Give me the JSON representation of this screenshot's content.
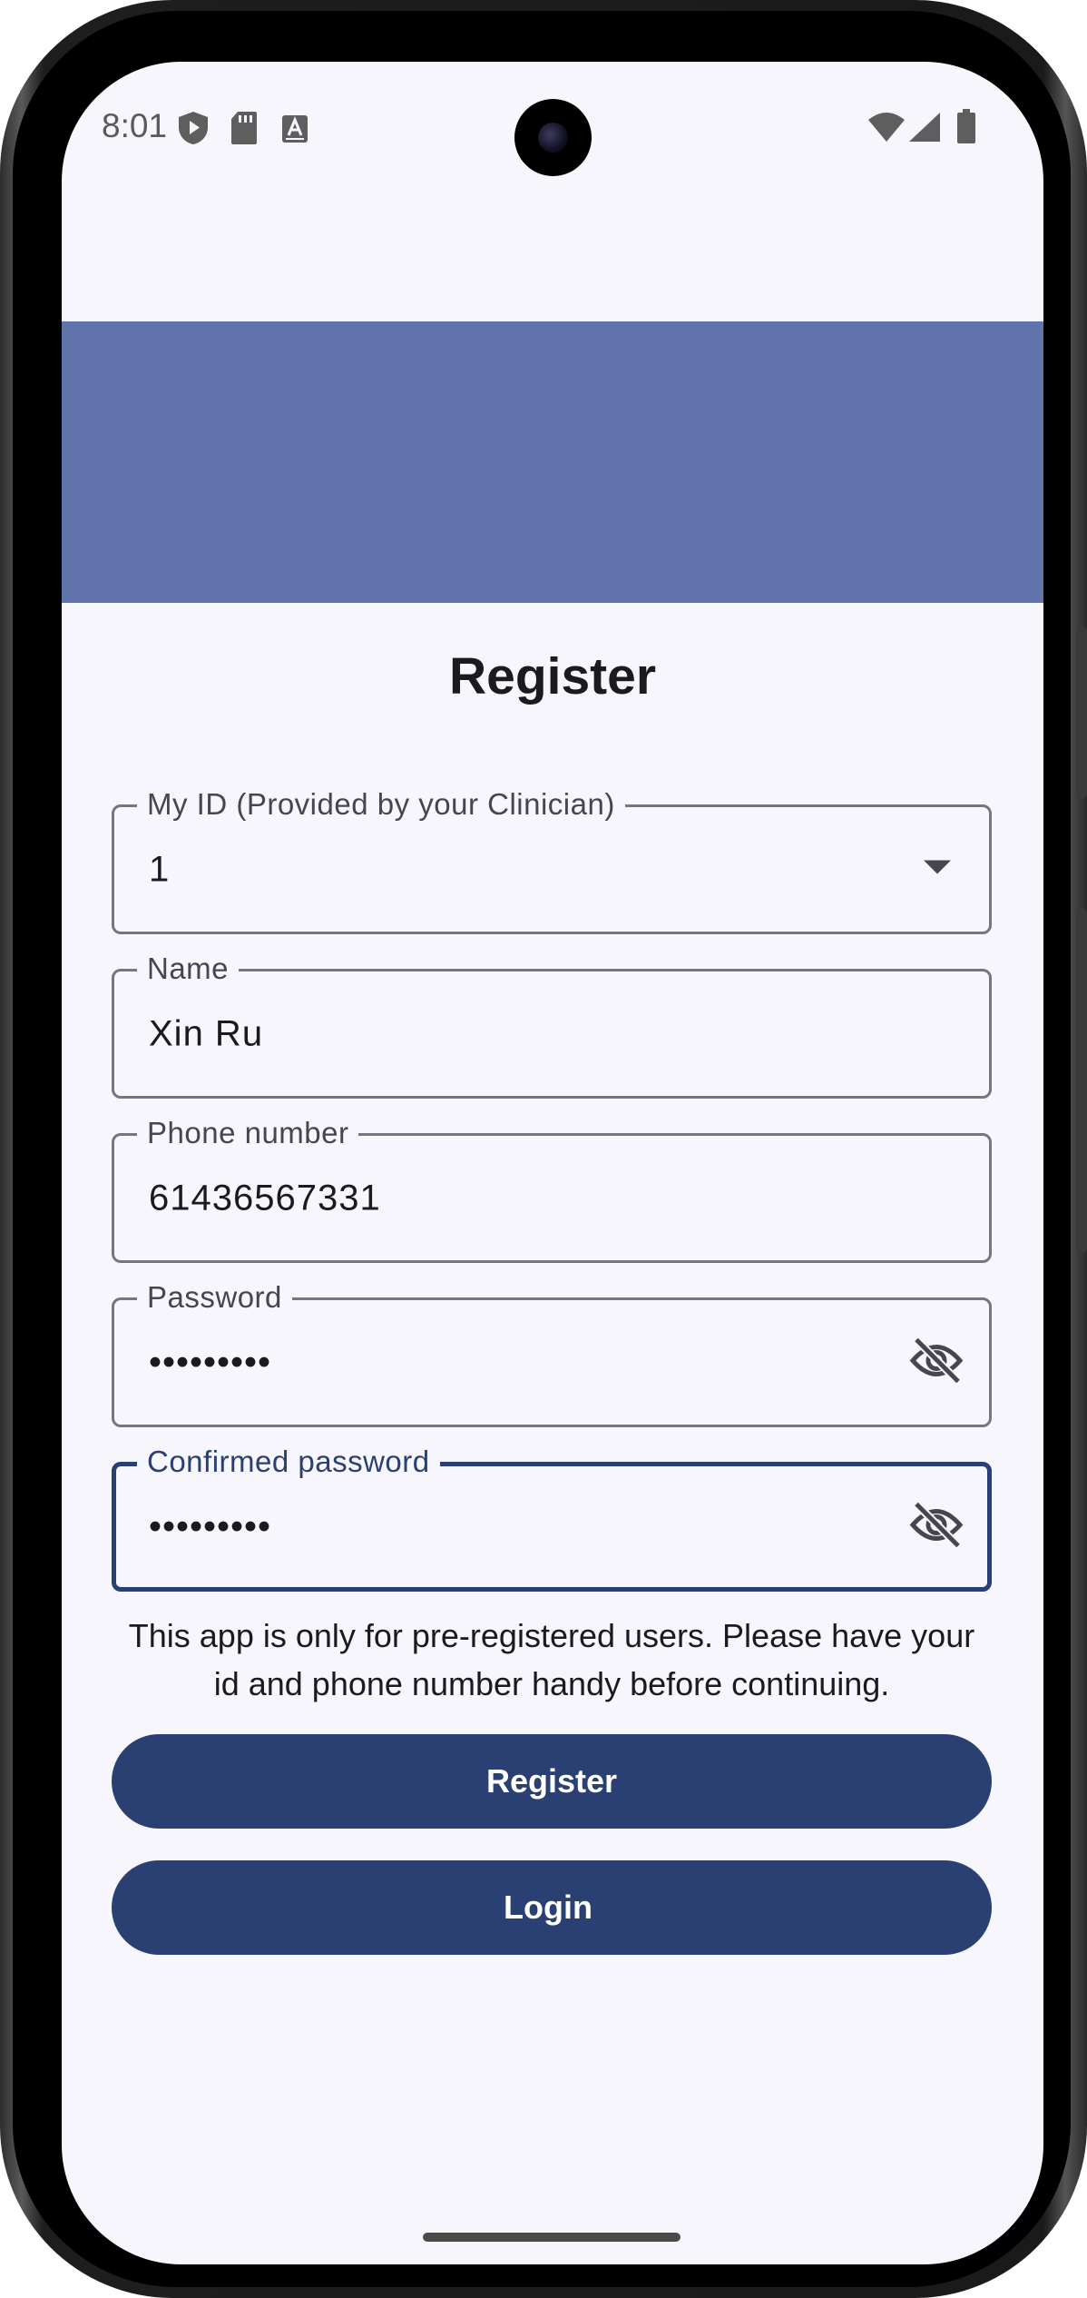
{
  "status_bar": {
    "time": "8:01",
    "left_icons": [
      "play-protect-icon",
      "sd-card-icon",
      "font-a-icon"
    ],
    "right_icons": [
      "wifi-icon",
      "signal-icon",
      "battery-icon"
    ]
  },
  "page": {
    "title": "Register"
  },
  "form": {
    "my_id": {
      "label": "My ID (Provided by your Clinician)",
      "value": "1",
      "icon": "dropdown-arrow-icon"
    },
    "name": {
      "label": "Name",
      "value": "Xin Ru"
    },
    "phone": {
      "label": "Phone number",
      "value": "61436567331"
    },
    "password": {
      "label": "Password",
      "value": "•••••••••",
      "icon": "visibility-off-icon"
    },
    "confirm_password": {
      "label": "Confirmed password",
      "value": "•••••••••",
      "icon": "visibility-off-icon"
    }
  },
  "note": "This app is only for pre-registered users. Please have your id and phone number handy before continuing.",
  "buttons": {
    "register": "Register",
    "login": "Login"
  },
  "colors": {
    "banner": "#6074ab",
    "primary": "#2b4072",
    "background": "#f7f6fc",
    "outline": "#77767e"
  }
}
